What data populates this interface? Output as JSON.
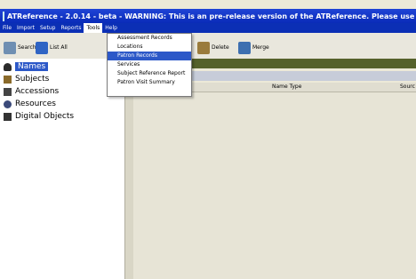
{
  "title_text": "ATReference - 2.0.14 - beta - WARNING: This is an pre-release version of the ATReference. Please use this vers",
  "menu": {
    "file": "File",
    "import": "Import",
    "setup": "Setup",
    "reports": "Reports",
    "tools": "Tools",
    "help": "Help"
  },
  "toolbar": {
    "search": "Search",
    "list_all": "List All",
    "delete": "Delete",
    "merge": "Merge"
  },
  "tools_menu": {
    "items": [
      "Assessment Records",
      "Locations",
      "Patron Records",
      "Services",
      "Subject Reference Report",
      "Patron Visit Summary"
    ],
    "highlighted_index": 2
  },
  "sidebar": {
    "items": [
      "Names",
      "Subjects",
      "Accessions",
      "Resources",
      "Digital Objects"
    ],
    "selected_index": 0
  },
  "table": {
    "columns": [
      "Name Type",
      "Sourc"
    ]
  },
  "colors": {
    "title_bar": "#0a2bb8",
    "selection": "#2c58c8",
    "header_bar": "#55612b"
  }
}
